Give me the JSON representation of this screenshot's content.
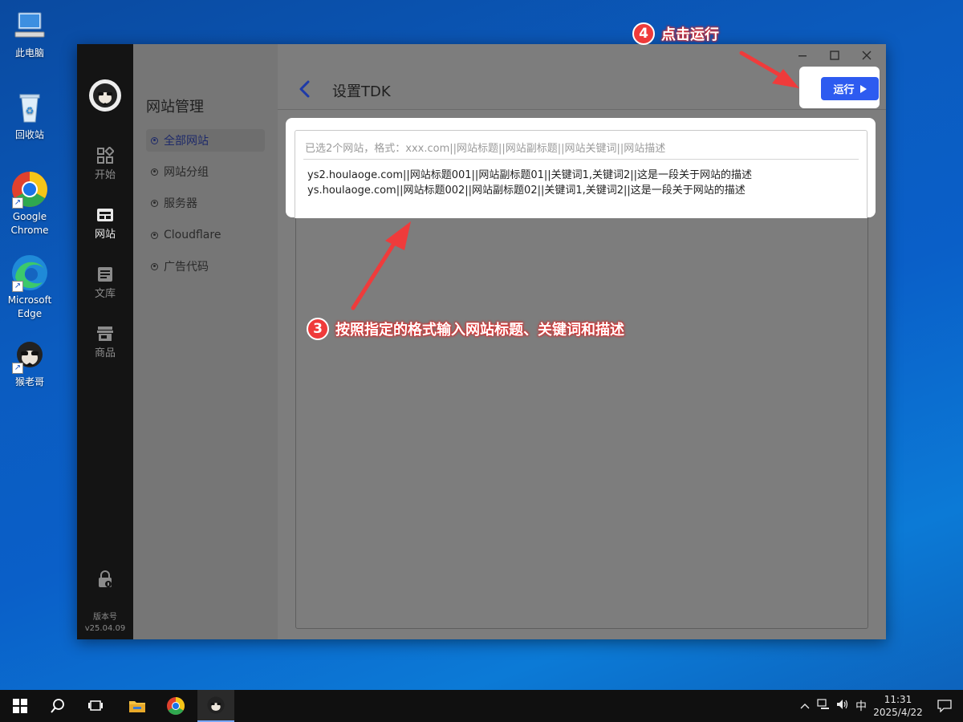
{
  "desktop": {
    "icons": [
      {
        "label": "此电脑"
      },
      {
        "label": "回收站"
      },
      {
        "label": "Google Chrome"
      },
      {
        "label": "Microsoft Edge"
      },
      {
        "label": "猴老哥"
      }
    ]
  },
  "app": {
    "rail": {
      "items": [
        {
          "label": "开始",
          "icon": "grid-icon"
        },
        {
          "label": "网站",
          "icon": "website-icon"
        },
        {
          "label": "文库",
          "icon": "document-icon"
        },
        {
          "label": "商品",
          "icon": "store-icon"
        }
      ],
      "version_label": "版本号",
      "version": "v25.04.09"
    },
    "subnav": {
      "title": "网站管理",
      "items": [
        {
          "label": "全部网站"
        },
        {
          "label": "网站分组"
        },
        {
          "label": "服务器"
        },
        {
          "label": "Cloudflare"
        },
        {
          "label": "广告代码"
        }
      ]
    },
    "header": {
      "title": "设置TDK",
      "run_label": "运行"
    },
    "editor": {
      "placeholder": "已选2个网站，格式：xxx.com||网站标题||网站副标题||网站关键词||网站描述",
      "lines": [
        "ys2.houlaoge.com||网站标题001||网站副标题01||关键词1,关键词2||这是一段关于网站的描述",
        "ys.houlaoge.com||网站标题002||网站副标题02||关键词1,关键词2||这是一段关于网站的描述"
      ]
    }
  },
  "annotations": {
    "step3": {
      "num": "3",
      "text": "按照指定的格式输入网站标题、关键词和描述"
    },
    "step4": {
      "num": "4",
      "text": "点击运行"
    }
  },
  "taskbar": {
    "ime": "中",
    "time": "11:31",
    "date": "2025/4/22"
  },
  "colors": {
    "accent": "#2d5bf0",
    "annotation": "#ef3b3b"
  }
}
